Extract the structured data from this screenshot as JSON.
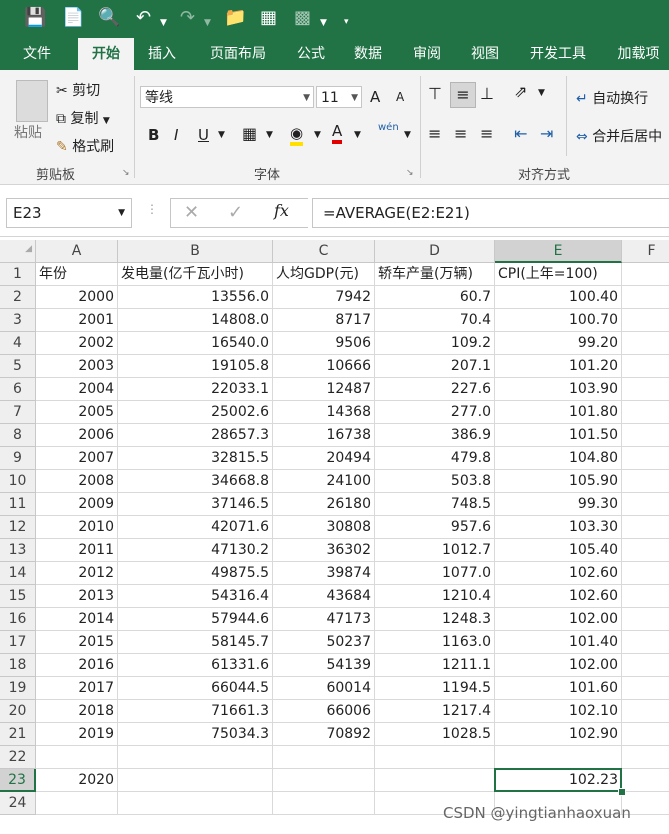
{
  "ribbon_tabs": [
    "文件",
    "开始",
    "插入",
    "页面布局",
    "公式",
    "数据",
    "审阅",
    "视图",
    "开发工具",
    "加载项"
  ],
  "active_tab": "开始",
  "clipboard": {
    "paste": "粘贴",
    "cut": "剪切",
    "copy": "复制",
    "format_painter": "格式刷",
    "group": "剪贴板"
  },
  "font": {
    "name": "等线",
    "size": "11",
    "grow": "A",
    "shrink": "A",
    "bold": "B",
    "italic": "I",
    "underline": "U",
    "color_letter": "A",
    "phonetic": "wén",
    "group": "字体"
  },
  "alignment": {
    "wrap": "自动换行",
    "merge": "合并后居中",
    "group": "对齐方式"
  },
  "formula_bar": {
    "name_box": "E23",
    "formula": "=AVERAGE(E2:E21)",
    "fx": "fx"
  },
  "columns": [
    "A",
    "B",
    "C",
    "D",
    "E",
    "F"
  ],
  "selected_column": "E",
  "selected_row": "23",
  "row_numbers": [
    "1",
    "2",
    "3",
    "4",
    "5",
    "6",
    "7",
    "8",
    "9",
    "10",
    "11",
    "12",
    "13",
    "14",
    "15",
    "16",
    "17",
    "18",
    "19",
    "20",
    "21",
    "22",
    "23",
    "24"
  ],
  "headers": [
    "年份",
    "发电量(亿千瓦小时)",
    "人均GDP(元)",
    "轿车产量(万辆)",
    "CPI(上年=100)"
  ],
  "rows": [
    [
      "2000",
      "13556.0",
      "7942",
      "60.7",
      "100.40"
    ],
    [
      "2001",
      "14808.0",
      "8717",
      "70.4",
      "100.70"
    ],
    [
      "2002",
      "16540.0",
      "9506",
      "109.2",
      "99.20"
    ],
    [
      "2003",
      "19105.8",
      "10666",
      "207.1",
      "101.20"
    ],
    [
      "2004",
      "22033.1",
      "12487",
      "227.6",
      "103.90"
    ],
    [
      "2005",
      "25002.6",
      "14368",
      "277.0",
      "101.80"
    ],
    [
      "2006",
      "28657.3",
      "16738",
      "386.9",
      "101.50"
    ],
    [
      "2007",
      "32815.5",
      "20494",
      "479.8",
      "104.80"
    ],
    [
      "2008",
      "34668.8",
      "24100",
      "503.8",
      "105.90"
    ],
    [
      "2009",
      "37146.5",
      "26180",
      "748.5",
      "99.30"
    ],
    [
      "2010",
      "42071.6",
      "30808",
      "957.6",
      "103.30"
    ],
    [
      "2011",
      "47130.2",
      "36302",
      "1012.7",
      "105.40"
    ],
    [
      "2012",
      "49875.5",
      "39874",
      "1077.0",
      "102.60"
    ],
    [
      "2013",
      "54316.4",
      "43684",
      "1210.4",
      "102.60"
    ],
    [
      "2014",
      "57944.6",
      "47173",
      "1248.3",
      "102.00"
    ],
    [
      "2015",
      "58145.7",
      "50237",
      "1163.0",
      "101.40"
    ],
    [
      "2016",
      "61331.6",
      "54139",
      "1211.1",
      "102.00"
    ],
    [
      "2017",
      "66044.5",
      "60014",
      "1194.5",
      "101.60"
    ],
    [
      "2018",
      "71661.3",
      "66006",
      "1217.4",
      "102.10"
    ],
    [
      "2019",
      "75034.3",
      "70892",
      "1028.5",
      "102.90"
    ]
  ],
  "row23": {
    "year": "2020",
    "cpi_avg": "102.23"
  },
  "watermark": "CSDN @yingtianhaoxuan"
}
